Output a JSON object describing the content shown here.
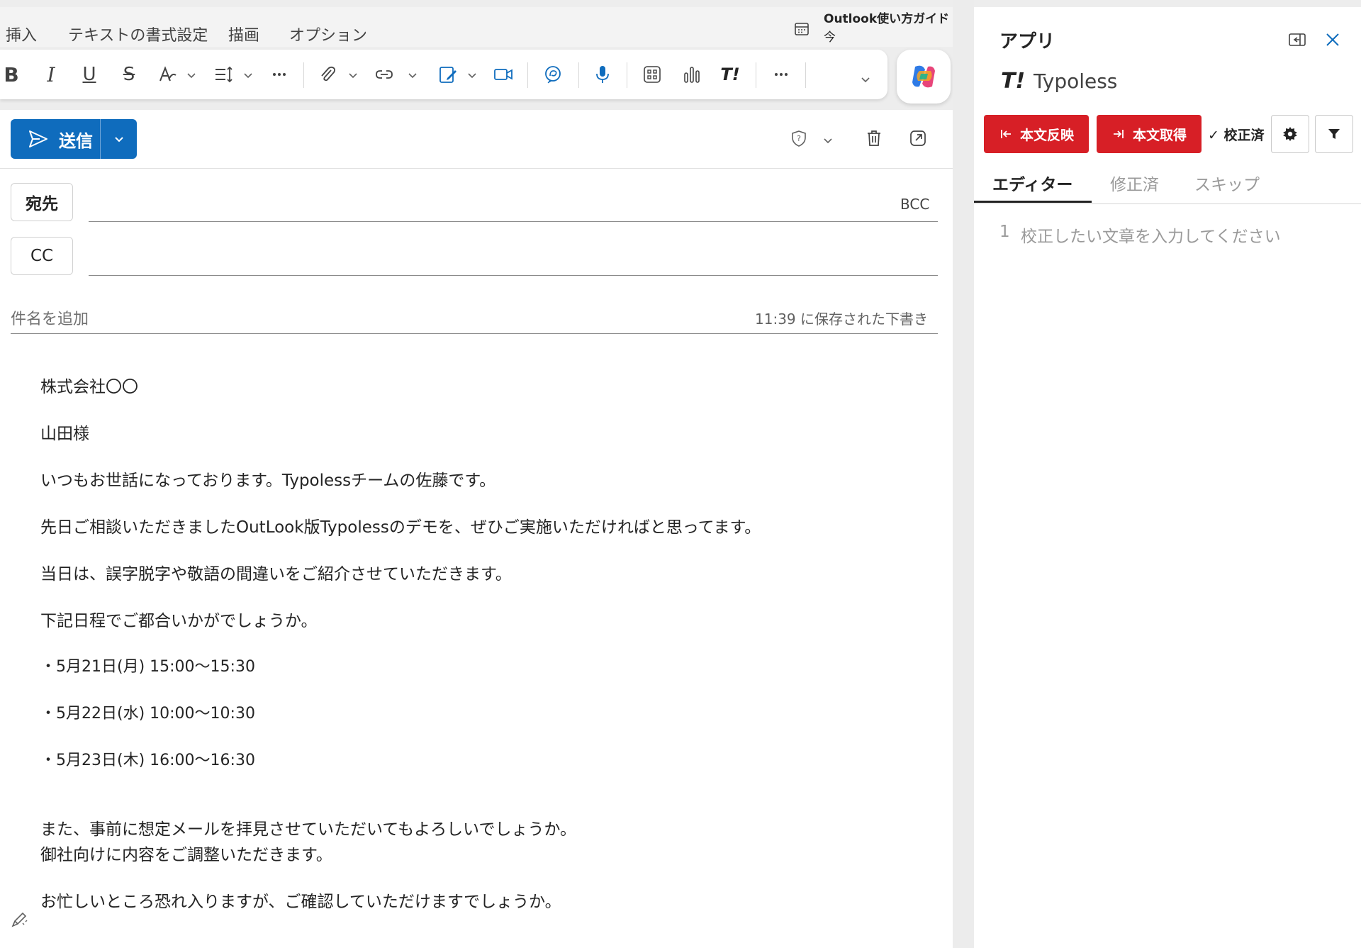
{
  "ribbon": {
    "tabs": [
      "挿入",
      "テキストの書式設定",
      "描画",
      "オプション"
    ],
    "guide_title": "Outlook使い方ガイド",
    "guide_subtitle": "今"
  },
  "toolbar": {
    "bold": "B",
    "italic": "I",
    "underline": "U",
    "strikethrough": "S",
    "typoless_logo": "T!"
  },
  "compose": {
    "send_label": "送信",
    "to_label": "宛先",
    "cc_label": "CC",
    "bcc_label": "BCC",
    "subject_placeholder": "件名を追加",
    "saved_status": "11:39 に保存された下書き",
    "body": [
      "株式会社〇〇",
      "山田様",
      "いつもお世話になっております。Typolessチームの佐藤です。",
      "先日ご相談いただきましたOutLook版Typolessのデモを、ぜひご実施いただければと思ってます。",
      "当日は、誤字脱字や敬語の間違いをご紹介させていただきます。",
      "下記日程でご都合いかがでしょうか。",
      "・5月21日(月) 15:00〜15:30",
      "・5月22日(水) 10:00〜10:30",
      "・5月23日(木) 16:00〜16:30",
      "また、事前に想定メールを拝見させていただいてもよろしいでしょうか。",
      "御社向けに内容をご調整いただきます。",
      "お忙しいところ恐れ入りますが、ご確認していただけますでしょうか。"
    ]
  },
  "app_pane": {
    "title": "アプリ",
    "logo": "T!",
    "app_name": "Typoless",
    "apply_button": "本文反映",
    "fetch_button": "本文取得",
    "fixed_badge": "✓ 校正済",
    "tabs": [
      "エディター",
      "修正済",
      "スキップ"
    ],
    "active_tab": "エディター",
    "editor_line_number": "1",
    "editor_placeholder": "校正したい文章を入力してください"
  },
  "colors": {
    "accent_blue": "#0f6cbd",
    "typoless_red": "#d71f26"
  }
}
